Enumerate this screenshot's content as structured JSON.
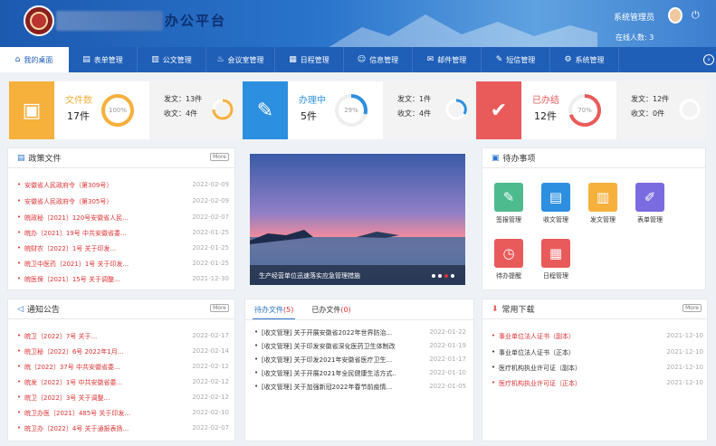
{
  "header": {
    "app_title": "办公平台",
    "user_name": "系统管理员",
    "online_label": "在线人数: 3"
  },
  "nav": [
    {
      "label": "我的桌面",
      "icon": "home-icon"
    },
    {
      "label": "表单管理",
      "icon": "form-icon"
    },
    {
      "label": "公文管理",
      "icon": "document-icon"
    },
    {
      "label": "会议室管理",
      "icon": "meeting-icon"
    },
    {
      "label": "日程管理",
      "icon": "calendar-icon"
    },
    {
      "label": "信息管理",
      "icon": "people-icon"
    },
    {
      "label": "邮件管理",
      "icon": "mail-icon"
    },
    {
      "label": "短信管理",
      "icon": "sms-icon"
    },
    {
      "label": "系统管理",
      "icon": "gear-icon"
    }
  ],
  "stats": [
    {
      "label": "文件数",
      "count": "17件",
      "pct": "100%",
      "fill": 1.0,
      "send": "发文：13件",
      "recv": "收文：4件",
      "color": "#f6b03c"
    },
    {
      "label": "办理中",
      "count": "5件",
      "pct": "29%",
      "fill": 0.29,
      "send": "发文：1件",
      "recv": "收文：4件",
      "color": "#2d8fe0"
    },
    {
      "label": "已办结",
      "count": "12件",
      "pct": "70%",
      "fill": 0.7,
      "send": "发文：12件",
      "recv": "收文：0件",
      "color": "#e95b5b"
    }
  ],
  "policy": {
    "title": "政策文件",
    "more": "More",
    "items": [
      {
        "title": "安徽省人民政府令（第309号）",
        "date": "2022-02-09"
      },
      {
        "title": "安徽省人民政府令（第305号）",
        "date": "2022-02-09"
      },
      {
        "title": "皖政秘〔2021〕120号安徽省人民...",
        "date": "2022-02-07"
      },
      {
        "title": "皖办〔2021〕19号 中共安徽省委...",
        "date": "2022-01-25"
      },
      {
        "title": "皖财农〔2022〕1号 关于印发...",
        "date": "2022-01-25"
      },
      {
        "title": "皖卫中医药〔2021〕1号 关于印发...",
        "date": "2022-01-25"
      },
      {
        "title": "皖医保〔2021〕15号 关于调整...",
        "date": "2021-12-30"
      }
    ]
  },
  "banner": {
    "caption": "生产经营单位迅速落实应急管理措施"
  },
  "todo": {
    "title": "待办事项",
    "tiles": [
      {
        "label": "签报管理",
        "color": "#4dbb8e",
        "icon": "edit-icon"
      },
      {
        "label": "收文管理",
        "color": "#2d8fe0",
        "icon": "inbox-icon"
      },
      {
        "label": "发文管理",
        "color": "#f6b03c",
        "icon": "outbox-icon"
      },
      {
        "label": "表单管理",
        "color": "#7a6be0",
        "icon": "form-icon"
      },
      {
        "label": "待办提醒",
        "color": "#e95b5b",
        "icon": "clock-icon"
      },
      {
        "label": "日程管理",
        "color": "#e95b5b",
        "icon": "calendar-icon"
      }
    ]
  },
  "notice": {
    "title": "通知公告",
    "more": "More",
    "items": [
      {
        "title": "皖卫〔2022〕7号 关于...",
        "date": "2022-02-17"
      },
      {
        "title": "皖卫秘〔2022〕6号 2022年1月...",
        "date": "2022-02-14"
      },
      {
        "title": "皖〔2022〕37号 中共安徽省委...",
        "date": "2022-02-12"
      },
      {
        "title": "皖发〔2022〕1号 中共安徽省委...",
        "date": "2022-02-12"
      },
      {
        "title": "皖卫〔2022〕3号 关于调整...",
        "date": "2022-02-12"
      },
      {
        "title": "皖卫办医〔2021〕485号 关于印发...",
        "date": "2022-02-10"
      },
      {
        "title": "皖卫办〔2022〕4号 关于通报表扬...",
        "date": "2022-02-07"
      }
    ]
  },
  "files": {
    "tab_pending": "待办文件",
    "tab_pending_count": "(5)",
    "tab_done": "已办文件",
    "tab_done_count": "(0)",
    "items": [
      {
        "title": "[收文管理] 关于开展安徽省2022年世界防治...",
        "date": "2022-01-22"
      },
      {
        "title": "[收文管理] 关于印发安徽省深化医药卫生体制改...",
        "date": "2022-01-19"
      },
      {
        "title": "[收文管理] 关于印发2021年安徽省医疗卫生...",
        "date": "2022-01-17"
      },
      {
        "title": "[收文管理] 关于开展2021年全民健康生活方式...",
        "date": "2022-01-10"
      },
      {
        "title": "[收文管理] 关于加强新冠2022年春节前疫情...",
        "date": "2022-01-05"
      }
    ]
  },
  "downloads": {
    "title": "常用下载",
    "more": "More",
    "items": [
      {
        "title": "事业单位法人证书（副本）",
        "date": "2021-12-10"
      },
      {
        "title": "事业单位法人证书（正本）",
        "date": "2021-12-10"
      },
      {
        "title": "医疗机构执业许可证（副本）",
        "date": "2021-12-10"
      },
      {
        "title": "医疗机构执业许可证（正本）",
        "date": "2021-12-10"
      }
    ]
  }
}
